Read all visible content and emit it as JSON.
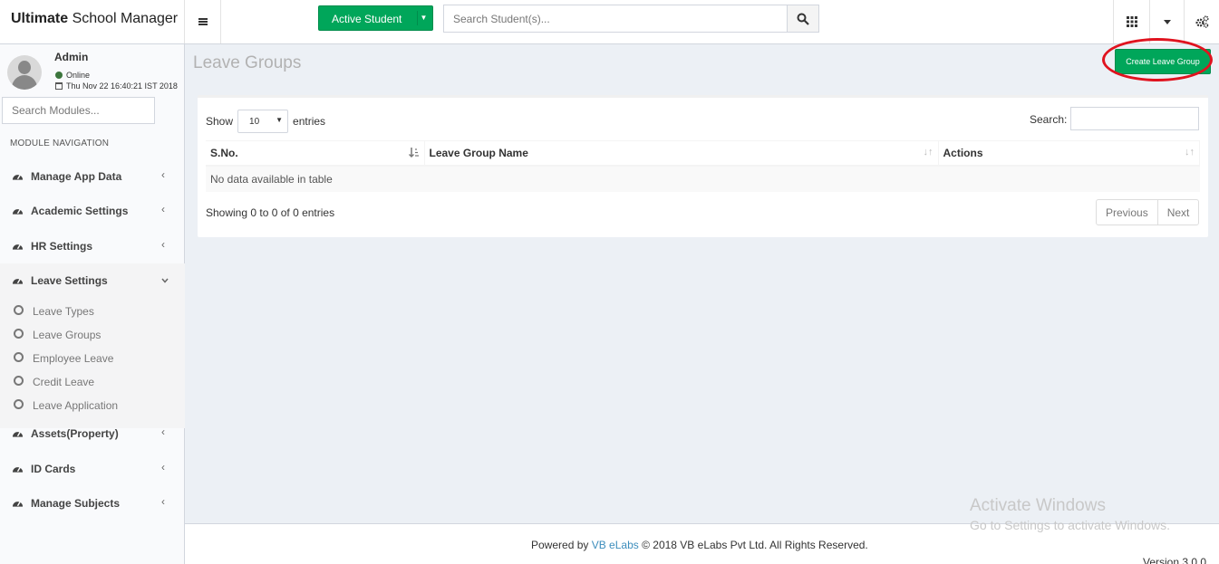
{
  "header": {
    "logo_bold": "Ultimate",
    "logo_rest": " School Manager",
    "active_student_label": "Active Student",
    "student_search_placeholder": "Search Student(s)..."
  },
  "sidebar": {
    "user_name": "Admin",
    "status": "Online",
    "datetime": "Thu Nov 22 16:40:21 IST 2018",
    "module_search_placeholder": "Search Modules...",
    "nav_heading": "MODULE NAVIGATION",
    "menu": [
      {
        "label": "Manage App Data"
      },
      {
        "label": "Academic Settings"
      },
      {
        "label": "HR Settings"
      },
      {
        "label": "Leave Settings"
      },
      {
        "label": "Assets(Property)"
      },
      {
        "label": "ID Cards"
      },
      {
        "label": "Manage Subjects"
      }
    ],
    "leave_sub": [
      {
        "label": "Leave Types"
      },
      {
        "label": "Leave Groups"
      },
      {
        "label": "Employee Leave"
      },
      {
        "label": "Credit Leave"
      },
      {
        "label": "Leave Application"
      }
    ]
  },
  "content": {
    "title": "Leave Groups",
    "create_button": "Create Leave Group",
    "show_label": "Show",
    "entries_value": "10",
    "entries_label": "entries",
    "search_label": "Search:",
    "columns": [
      "S.No.",
      "Leave Group Name",
      "Actions"
    ],
    "empty_message": "No data available in table",
    "info": "Showing 0 to 0 of 0 entries",
    "prev": "Previous",
    "next": "Next"
  },
  "footer": {
    "powered_by": "Powered by",
    "brand_link": "VB eLabs",
    "copyright": " © 2018 VB eLabs Pvt Ltd. All Rights Reserved.",
    "version": "Version 3.0.0"
  },
  "watermark": {
    "line1": "Activate Windows",
    "line2": "Go to Settings to activate Windows."
  },
  "colors": {
    "accent_green": "#00a65a",
    "highlight_red": "#e0131f",
    "link_blue": "#3c8dbc"
  }
}
